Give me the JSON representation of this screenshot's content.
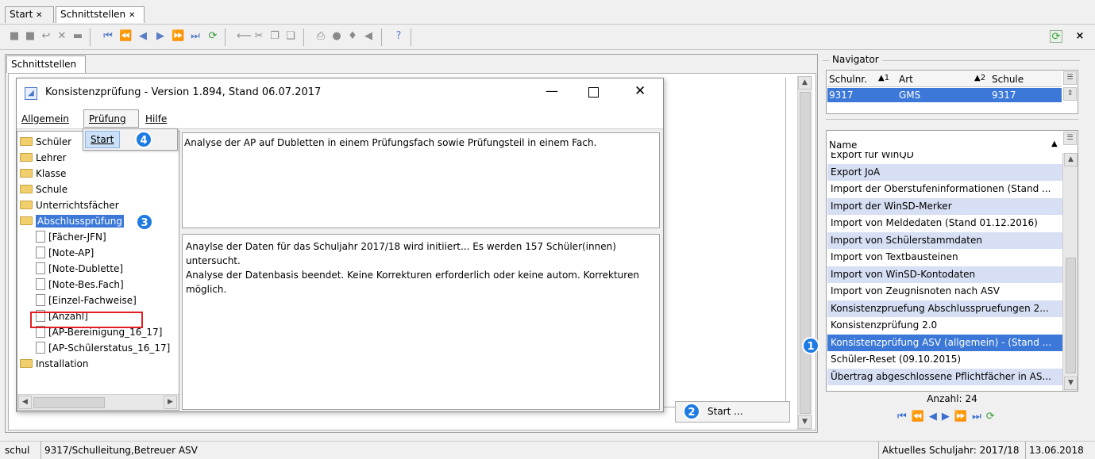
{
  "tabs": [
    {
      "label": "Start",
      "close": "✕"
    },
    {
      "label": "Schnittstellen",
      "close": "✕"
    }
  ],
  "left_panel": {
    "tab_label": "Schnittstellen"
  },
  "dialog": {
    "title": "Konsistenzprüfung - Version 1.894, Stand 06.07.2017",
    "menu": [
      "Allgemein",
      "Prüfung",
      "Hilfe"
    ],
    "dropdown_item": "Start",
    "tree": [
      {
        "label": "Schüler",
        "type": "folder"
      },
      {
        "label": "Lehrer",
        "type": "folder"
      },
      {
        "label": "Klasse",
        "type": "folder"
      },
      {
        "label": "Schule",
        "type": "folder"
      },
      {
        "label": "Unterrichtsfächer",
        "type": "folder"
      },
      {
        "label": "Abschlussprüfung",
        "type": "folder",
        "selected": true
      },
      {
        "label": "[Fächer-JFN]",
        "type": "doc"
      },
      {
        "label": "[Note-AP]",
        "type": "doc"
      },
      {
        "label": "[Note-Dublette]",
        "type": "doc"
      },
      {
        "label": "[Note-Bes.Fach]",
        "type": "doc"
      },
      {
        "label": "[Einzel-Fachweise]",
        "type": "doc"
      },
      {
        "label": "[Anzahl]",
        "type": "doc",
        "highlight": true
      },
      {
        "label": "[AP-Bereinigung_16_17]",
        "type": "doc"
      },
      {
        "label": "[AP-Schülerstatus_16_17]",
        "type": "doc"
      },
      {
        "label": "Installation",
        "type": "folder"
      }
    ],
    "description": "Analyse der AP auf Dubletten in einem Prüfungsfach sowie Prüfungsteil in einem Fach.",
    "log": "Anaylse der Daten für das Schuljahr 2017/18 wird initiiert... Es werden 157 Schüler(innen) untersucht.\nAnalyse der Datenbasis beendet. Keine Korrekturen erforderlich oder keine autom. Korrekturen möglich."
  },
  "start_button": "Start ...",
  "badges": [
    "1",
    "2",
    "3",
    "4"
  ],
  "navigator": {
    "title": "Navigator",
    "school_headers": [
      "Schulnr.",
      "Art",
      "Schule"
    ],
    "sort_marks": [
      "1",
      "2"
    ],
    "school_row": [
      "9317",
      "GMS",
      "9317"
    ],
    "list_header": "Name",
    "items": [
      "Export für WinQD",
      "Export JoA",
      "Import der Oberstufeninformationen (Stand ...",
      "Import der WinSD-Merker",
      "Import von Meldedaten (Stand 01.12.2016)",
      "Import von Schülerstammdaten",
      "Import von Textbausteinen",
      "Import von WinSD-Kontodaten",
      "Import von Zeugnisnoten nach ASV",
      "Konsistenzpruefung Abschlusspruefungen 2...",
      "Konsistenzprüfung 2.0",
      "Konsistenzprüfung ASV (allgemein) - (Stand ...",
      "Schüler-Reset (09.10.2015)",
      "Übertrag abgeschlossene Pflichtfächer in AS..."
    ],
    "selected_index": 11,
    "count": "Anzahl: 24"
  },
  "status": {
    "user": "schul",
    "role": "9317/Schulleitung,Betreuer ASV",
    "year": "Aktuelles Schuljahr: 2017/18",
    "date": "13.06.2018"
  },
  "colors": {
    "accent": "#3b78d8",
    "badge": "#1e7be3",
    "highlight_box": "#e02020"
  }
}
